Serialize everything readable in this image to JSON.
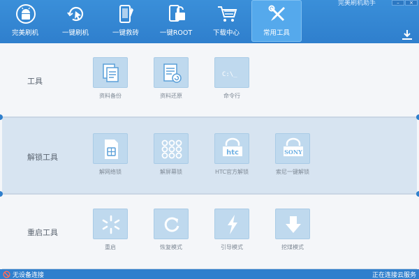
{
  "window": {
    "title": "完美刷机助手"
  },
  "nav": {
    "items": [
      {
        "label": "完美刷机",
        "icon": "android-icon"
      },
      {
        "label": "一键刷机",
        "icon": "flash-refresh-icon"
      },
      {
        "label": "一键救砖",
        "icon": "phone-wrench-icon"
      },
      {
        "label": "一键ROOT",
        "icon": "unlock-icon"
      },
      {
        "label": "下载中心",
        "icon": "cart-icon"
      },
      {
        "label": "常用工具",
        "icon": "tools-icon"
      }
    ],
    "active_index": 5
  },
  "sections": {
    "tools": {
      "title": "工具",
      "items": [
        {
          "label": "资料备份",
          "icon": "backup-icon"
        },
        {
          "label": "资料还原",
          "icon": "restore-icon"
        },
        {
          "label": "命令行",
          "icon": "terminal-icon",
          "glyph": "C:\\_"
        }
      ]
    },
    "unlock": {
      "title": "解锁工具",
      "items": [
        {
          "label": "解网络锁",
          "icon": "sim-icon"
        },
        {
          "label": "解屏幕锁",
          "icon": "pattern-lock-icon"
        },
        {
          "label": "HTC官方解锁",
          "icon": "htc-icon",
          "glyph": "htc"
        },
        {
          "label": "索尼一键解锁",
          "icon": "sony-icon",
          "glyph": "SONY"
        }
      ]
    },
    "reboot": {
      "title": "重启工具",
      "items": [
        {
          "label": "重启",
          "icon": "reboot-icon"
        },
        {
          "label": "恢复模式",
          "icon": "recovery-icon"
        },
        {
          "label": "引导模式",
          "icon": "bootloader-icon"
        },
        {
          "label": "挖煤模式",
          "icon": "download-mode-icon"
        }
      ]
    }
  },
  "status": {
    "left": "无设备连接",
    "right": "正在连接云服务"
  },
  "colors": {
    "primary": "#2f7fcd",
    "active_tab": "#55a9ec",
    "tile": "#bfd9ee"
  }
}
